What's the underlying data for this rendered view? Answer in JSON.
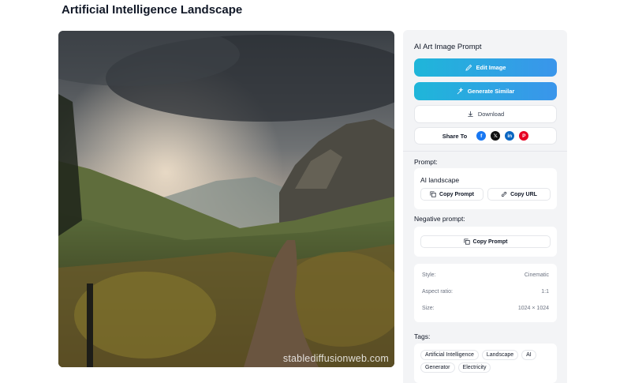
{
  "page": {
    "title": "Artificial Intelligence Landscape"
  },
  "image": {
    "watermark": "stablediffusionweb.com"
  },
  "panel": {
    "title": "AI Art Image Prompt",
    "buttons": {
      "edit": "Edit Image",
      "similar": "Generate Similar",
      "download": "Download"
    },
    "share": {
      "label": "Share To",
      "icons": [
        "facebook-icon",
        "x-icon",
        "linkedin-icon",
        "pinterest-icon"
      ]
    },
    "prompt": {
      "label": "Prompt:",
      "text": "AI landscape",
      "copy_prompt": "Copy Prompt",
      "copy_url": "Copy URL"
    },
    "negative": {
      "label": "Negative prompt:",
      "copy_prompt": "Copy Prompt"
    },
    "meta": [
      {
        "key": "Style:",
        "value": "Cinematic"
      },
      {
        "key": "Aspect ratio:",
        "value": "1:1"
      },
      {
        "key": "Size:",
        "value": "1024 × 1024"
      }
    ],
    "tags": {
      "label": "Tags:",
      "items": [
        "Artificial Intelligence",
        "Landscape",
        "AI",
        "Generator",
        "Electricity"
      ]
    }
  },
  "colors": {
    "accent_start": "#1fb6d9",
    "accent_end": "#3a95eb",
    "panel_bg": "#f3f4f6"
  }
}
